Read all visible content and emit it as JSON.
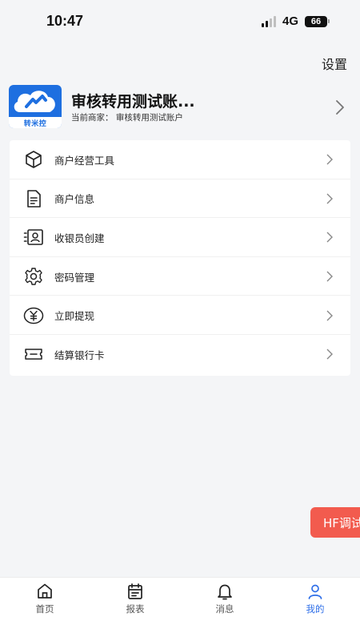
{
  "status": {
    "time": "10:47",
    "network": "4G",
    "battery": "66"
  },
  "header": {
    "settings_label": "设置"
  },
  "profile": {
    "name": "审核转用测试账...",
    "merchant_prefix": "当前商家：",
    "merchant_name": "审核转用测试账户",
    "avatar_logo_text": "转米控"
  },
  "menu": {
    "items": [
      {
        "label": "商户经营工具",
        "icon": "box-icon"
      },
      {
        "label": "商户信息",
        "icon": "document-icon"
      },
      {
        "label": "收银员创建",
        "icon": "cashier-id-icon"
      },
      {
        "label": "密码管理",
        "icon": "gear-icon"
      },
      {
        "label": "立即提现",
        "icon": "yuan-icon"
      },
      {
        "label": "结算银行卡",
        "icon": "bank-card-icon"
      }
    ]
  },
  "floating": {
    "label": "HF调试"
  },
  "tabbar": {
    "items": [
      {
        "label": "首页",
        "icon": "home-icon",
        "active": false
      },
      {
        "label": "报表",
        "icon": "calendar-report-icon",
        "active": false
      },
      {
        "label": "消息",
        "icon": "bell-icon",
        "active": false
      },
      {
        "label": "我的",
        "icon": "user-icon",
        "active": true
      }
    ]
  },
  "colors": {
    "accent": "#2f6fe8",
    "float_button": "#f25b4e",
    "background": "#f4f5f7"
  }
}
